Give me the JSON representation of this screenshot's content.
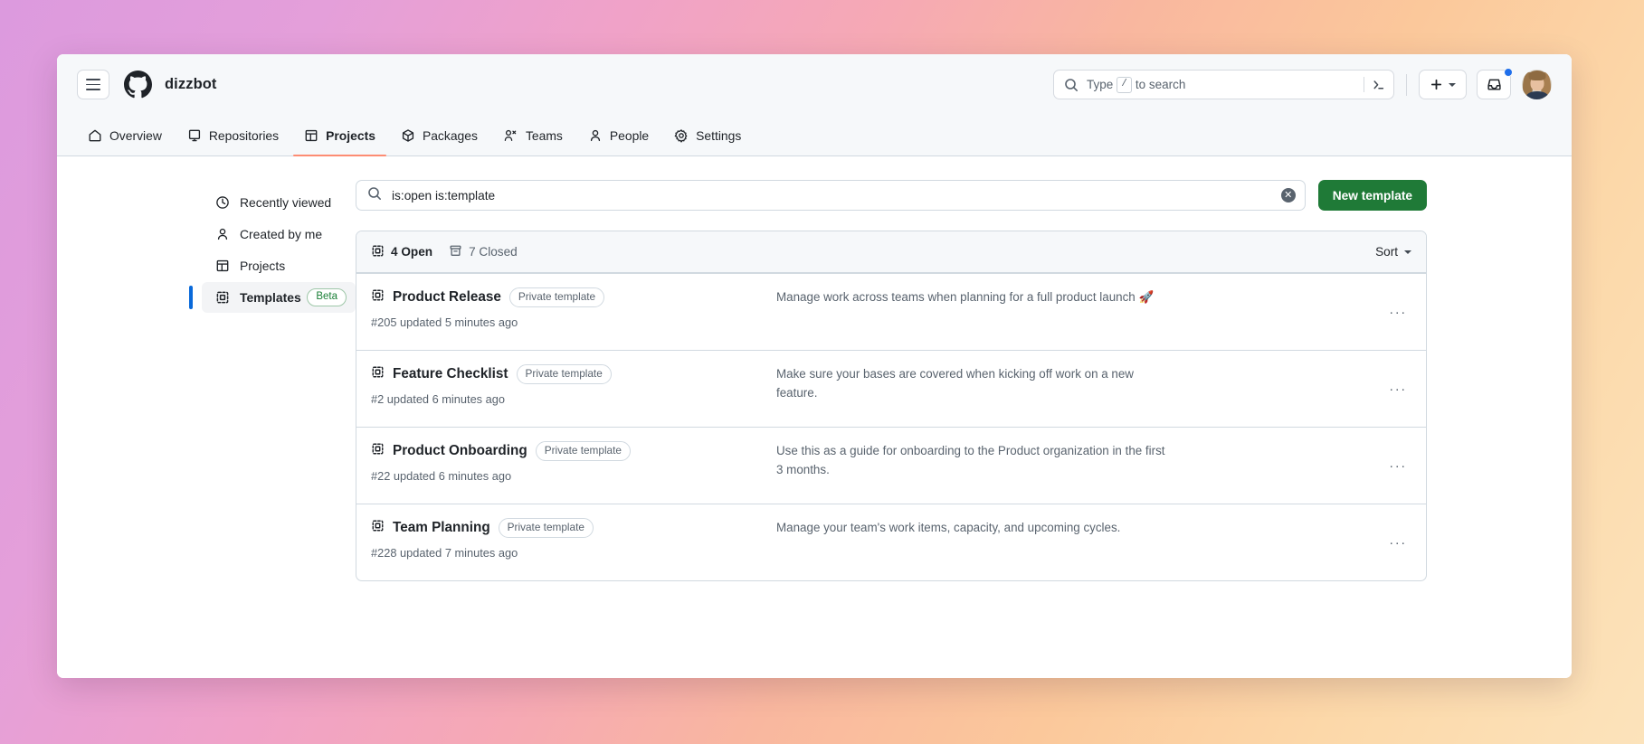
{
  "header": {
    "menu_icon": "hamburger-icon",
    "logo_icon": "github-mark-icon",
    "org_name": "dizzbot",
    "search": {
      "icon": "search-icon",
      "placeholder_prefix": "Type",
      "slash_key": "/",
      "placeholder_suffix": "to search",
      "terminal_icon": "terminal-icon"
    },
    "create_button": {
      "icon": "plus-icon",
      "caret": "chevron-down-icon"
    },
    "inbox_button": {
      "icon": "inbox-icon",
      "has_unread": true
    },
    "avatar": "user-avatar"
  },
  "nav": {
    "tabs": [
      {
        "label": "Overview",
        "icon": "home-icon",
        "active": false
      },
      {
        "label": "Repositories",
        "icon": "repo-icon",
        "active": false
      },
      {
        "label": "Projects",
        "icon": "project-table-icon",
        "active": true
      },
      {
        "label": "Packages",
        "icon": "package-icon",
        "active": false
      },
      {
        "label": "Teams",
        "icon": "people-icon",
        "active": false
      },
      {
        "label": "People",
        "icon": "person-icon",
        "active": false
      },
      {
        "label": "Settings",
        "icon": "gear-icon",
        "active": false
      }
    ]
  },
  "sidebar": {
    "items": [
      {
        "label": "Recently viewed",
        "icon": "clock-icon",
        "active": false,
        "badge": null
      },
      {
        "label": "Created by me",
        "icon": "person-icon",
        "active": false,
        "badge": null
      },
      {
        "label": "Projects",
        "icon": "project-table-icon",
        "active": false,
        "badge": null
      },
      {
        "label": "Templates",
        "icon": "template-icon",
        "active": true,
        "badge": "Beta"
      }
    ]
  },
  "filter": {
    "search_icon": "search-icon",
    "value": "is:open is:template",
    "clear_icon": "clear-x-icon",
    "new_template_label": "New template",
    "new_template_color": "#1f7a37"
  },
  "list": {
    "open_count_label": "4 Open",
    "open_icon": "template-icon",
    "closed_count_label": "7 Closed",
    "closed_icon": "archive-icon",
    "sort_label": "Sort",
    "sort_caret": "chevron-down-icon",
    "rows": [
      {
        "icon": "template-icon",
        "title": "Product Release",
        "visibility": "Private template",
        "meta": "#205 updated 5 minutes ago",
        "description": "Manage work across teams when planning for a full product launch 🚀",
        "menu": "···"
      },
      {
        "icon": "template-icon",
        "title": "Feature Checklist",
        "visibility": "Private template",
        "meta": "#2 updated 6 minutes ago",
        "description": "Make sure your bases are covered when kicking off work on a new feature.",
        "menu": "···"
      },
      {
        "icon": "template-icon",
        "title": "Product Onboarding",
        "visibility": "Private template",
        "meta": "#22 updated 6 minutes ago",
        "description": "Use this as a guide for onboarding to the Product organization in the first 3 months.",
        "menu": "···"
      },
      {
        "icon": "template-icon",
        "title": "Team Planning",
        "visibility": "Private template",
        "meta": "#228 updated 7 minutes ago",
        "description": "Manage your team's work items, capacity, and upcoming cycles.",
        "menu": "···"
      }
    ]
  },
  "theme": {
    "accent_blue": "#0969da",
    "active_tab_underline": "#fd8c73",
    "green": "#1f7a37",
    "beta_green": "#1a7f37",
    "bg_gradient_from": "#dc9ade",
    "bg_gradient_to": "#fce3bb"
  }
}
